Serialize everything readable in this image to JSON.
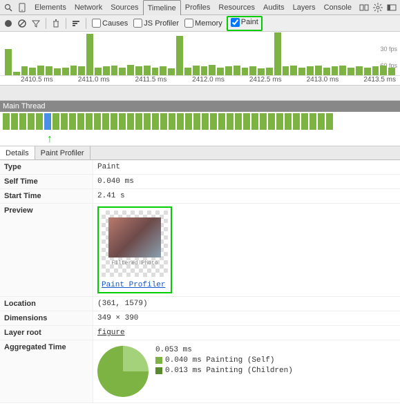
{
  "tabs": {
    "items": [
      "Elements",
      "Network",
      "Sources",
      "Timeline",
      "Profiles",
      "Resources",
      "Audits",
      "Layers",
      "Console"
    ],
    "active": "Timeline"
  },
  "toolbar": {
    "causes": "Causes",
    "js": "JS Profiler",
    "memory": "Memory",
    "paint": "Paint"
  },
  "fps": {
    "l1": "30 fps",
    "l2": "60 fps"
  },
  "axis": [
    "2410.5 ms",
    "2411.0 ms",
    "2411.5 ms",
    "2412.0 ms",
    "2412.5 ms",
    "2413.0 ms",
    "2413.5 ms"
  ],
  "main_thread_label": "Main Thread",
  "dtabs": {
    "details": "Details",
    "profiler": "Paint Profiler"
  },
  "rows": {
    "type": {
      "k": "Type",
      "v": "Paint"
    },
    "self": {
      "k": "Self Time",
      "v": "0.040 ms"
    },
    "start": {
      "k": "Start Time",
      "v": "2.41 s"
    },
    "preview": {
      "k": "Preview",
      "link": "Paint Profiler",
      "caption": "Filtered Photo"
    },
    "location": {
      "k": "Location",
      "v": "(361, 1579)"
    },
    "dim": {
      "k": "Dimensions",
      "v": "349 × 390"
    },
    "layer": {
      "k": "Layer root",
      "v": "figure"
    },
    "agg": {
      "k": "Aggregated Time",
      "total": "0.053 ms",
      "self": "0.040 ms Painting (Self)",
      "children": "0.013 ms Painting (Children)"
    }
  },
  "colors": {
    "green": "#7cb342",
    "lightgreen": "#a4d27a",
    "highlight": "#00cc00"
  }
}
